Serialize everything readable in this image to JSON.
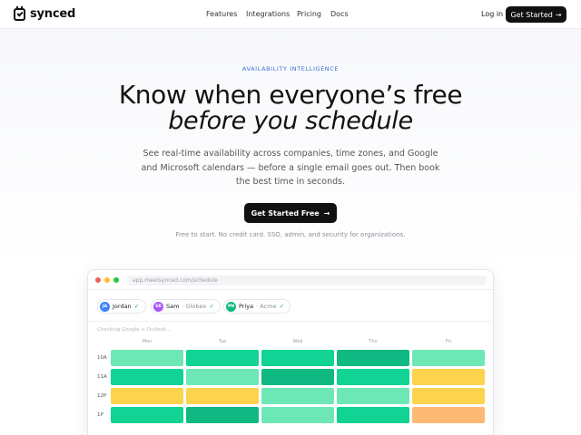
{
  "nav": {
    "brand": "synced",
    "links": [
      "Features",
      "Integrations",
      "Pricing",
      "Docs"
    ],
    "login": "Log in",
    "cta": "Get Started",
    "cta_arrow": "→"
  },
  "hero": {
    "eyebrow": "AVAILABILITY INTELLIGENCE",
    "title_line1": "Know when everyone’s free",
    "title_line2": "before you schedule",
    "subtitle": "See real-time availability across companies, time zones, and Google and Microsoft calendars — before a single email goes out. Then book the best time in seconds.",
    "cta": "Get Started Free",
    "cta_arrow": "→",
    "fine_print": "Free to start. No credit card. SSO, admin, and security for organizations."
  },
  "preview": {
    "url": "app.meetsynced.com/schedule",
    "window_dots": [
      "#f25f58",
      "#fbbe2e",
      "#27c840"
    ],
    "participants": [
      {
        "initials": "JA",
        "name": "Jordan",
        "org": "",
        "color": "#3b82f6",
        "check": "✓"
      },
      {
        "initials": "SR",
        "name": "Sam",
        "org": "· Globex",
        "color": "#a855f7",
        "check": "✓"
      },
      {
        "initials": "PN",
        "name": "Priya",
        "org": "· Acme",
        "color": "#10b981",
        "check": "✓"
      }
    ],
    "status": "Checking Google + Outlook...",
    "days": [
      "Mon",
      "Tue",
      "Wed",
      "Thu",
      "Fri"
    ],
    "times": [
      "10A",
      "11A",
      "12P",
      "1P"
    ],
    "legend_colors": {
      "free_light": "#6ee7b7",
      "free": "#10d394",
      "free_dark": "#10b981",
      "partial": "#fcd34d",
      "busy": "#fdba74"
    },
    "grid": [
      [
        "free_light",
        "free",
        "free",
        "free_dark",
        "free_light"
      ],
      [
        "free",
        "free_light",
        "free_dark",
        "free",
        "partial"
      ],
      [
        "partial",
        "partial",
        "free_light",
        "free_light",
        "partial"
      ],
      [
        "free",
        "free_dark",
        "free_light",
        "free",
        "busy"
      ]
    ]
  }
}
